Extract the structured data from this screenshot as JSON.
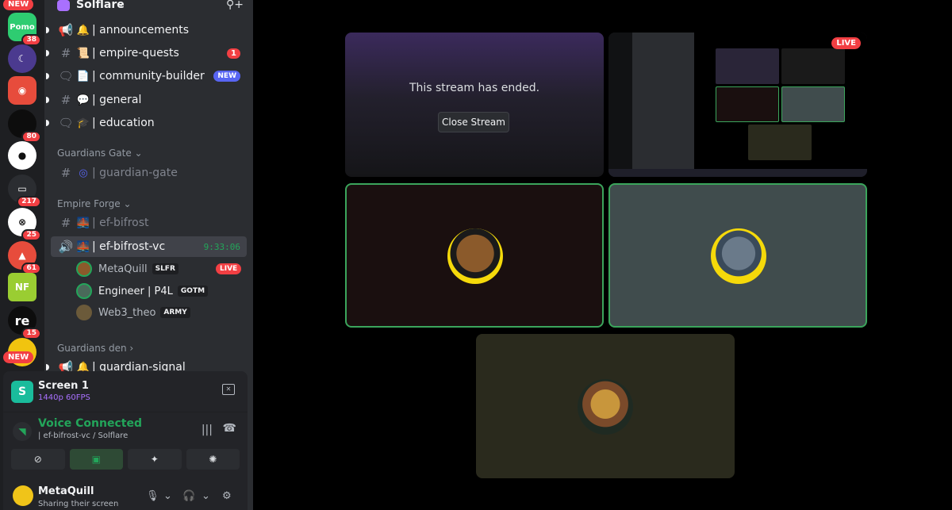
{
  "rail": {
    "new_top": "NEW",
    "new_bottom": "NEW",
    "servers": [
      {
        "label": "Pomo",
        "badge": "38",
        "color": "#2ecc71"
      },
      {
        "label": "",
        "badge": "",
        "color": "#4b3a8f"
      },
      {
        "label": "",
        "badge": "",
        "color": "#e74c3c"
      },
      {
        "label": "",
        "badge": "80",
        "color": "#111"
      },
      {
        "label": "",
        "badge": "",
        "color": "#fff"
      },
      {
        "label": "",
        "badge": "217",
        "color": "#2b2d31"
      },
      {
        "label": "",
        "badge": "25",
        "color": "#fff"
      },
      {
        "label": "",
        "badge": "61",
        "color": "#e74c3c"
      },
      {
        "label": "NF",
        "badge": "",
        "color": "#9acd32"
      },
      {
        "label": "re",
        "badge": "15",
        "color": "#111"
      },
      {
        "label": "",
        "badge": "",
        "color": "#f1c40f"
      }
    ]
  },
  "sidebar": {
    "server_name": "Solflare",
    "channels": [
      {
        "name": "| announcements",
        "icon": "📢",
        "emoji": "🔔",
        "right": ""
      },
      {
        "name": "| empire-quests",
        "icon": "#",
        "emoji": "📜",
        "right": "1"
      },
      {
        "name": "| community-builder",
        "icon": "🗨",
        "emoji": "📄",
        "right": "NEW"
      },
      {
        "name": "| general",
        "icon": "#",
        "emoji": "💬",
        "right": ""
      },
      {
        "name": "| education",
        "icon": "🗨",
        "emoji": "🎓",
        "right": ""
      }
    ],
    "cat_guardians_gate": "Guardians Gate",
    "guardian_gate_channel": "| guardian-gate",
    "cat_empire_forge": "Empire Forge",
    "ef_bifrost": "| ef-bifrost",
    "ef_bifrost_vc": "| ef-bifrost-vc",
    "vc_timer": "9:33:06",
    "voice_users": [
      {
        "name": "MetaQuill",
        "tag": "SLFR",
        "live": "LIVE"
      },
      {
        "name": "Engineer | P4L",
        "tag": "GOTM",
        "live": ""
      },
      {
        "name": "Web3_theo",
        "tag": "ARMY",
        "live": ""
      }
    ],
    "cat_guardians_den": "Guardians den",
    "guardian_signal": "| guardian-signal"
  },
  "panel": {
    "screen_title": "Screen 1",
    "screen_sub": "1440p 60FPS",
    "vc_title": "Voice Connected",
    "vc_sub": "| ef-bifrost-vc / Solflare",
    "user_name": "MetaQuill",
    "user_status": "Sharing their screen"
  },
  "stage": {
    "ended_text": "This stream has ended.",
    "close_button": "Close Stream",
    "live": "LIVE"
  }
}
